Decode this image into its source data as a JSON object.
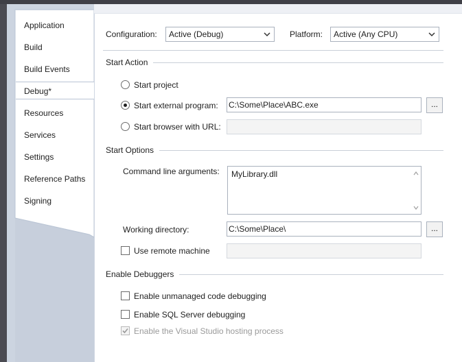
{
  "nav": {
    "tabs": [
      {
        "label": "Application"
      },
      {
        "label": "Build"
      },
      {
        "label": "Build Events"
      },
      {
        "label": "Debug*"
      },
      {
        "label": "Resources"
      },
      {
        "label": "Services"
      },
      {
        "label": "Settings"
      },
      {
        "label": "Reference Paths"
      },
      {
        "label": "Signing"
      }
    ],
    "active_index": 3
  },
  "config": {
    "configuration_label": "Configuration:",
    "configuration_value": "Active (Debug)",
    "platform_label": "Platform:",
    "platform_value": "Active (Any CPU)"
  },
  "start_action": {
    "heading": "Start Action",
    "start_project": "Start project",
    "start_external": "Start external program:",
    "external_path": "C:\\Some\\Place\\ABC.exe",
    "start_browser": "Start browser with URL:",
    "browser_url": "",
    "browse_label": "...",
    "selected": "start_external"
  },
  "start_options": {
    "heading": "Start Options",
    "cmd_label": "Command line arguments:",
    "cmd_value": "MyLibrary.dll",
    "working_dir_label": "Working directory:",
    "working_dir_value": "C:\\Some\\Place\\",
    "browse_label": "...",
    "remote_label": "Use remote machine",
    "remote_value": ""
  },
  "debuggers": {
    "heading": "Enable Debuggers",
    "unmanaged": "Enable unmanaged code debugging",
    "sql": "Enable SQL Server debugging",
    "hosting": "Enable the Visual Studio hosting process"
  },
  "colors": {
    "nav_background": "#ccd4e0",
    "accent_border": "#a9b1bd",
    "disabled_text": "#9a9a9a"
  }
}
